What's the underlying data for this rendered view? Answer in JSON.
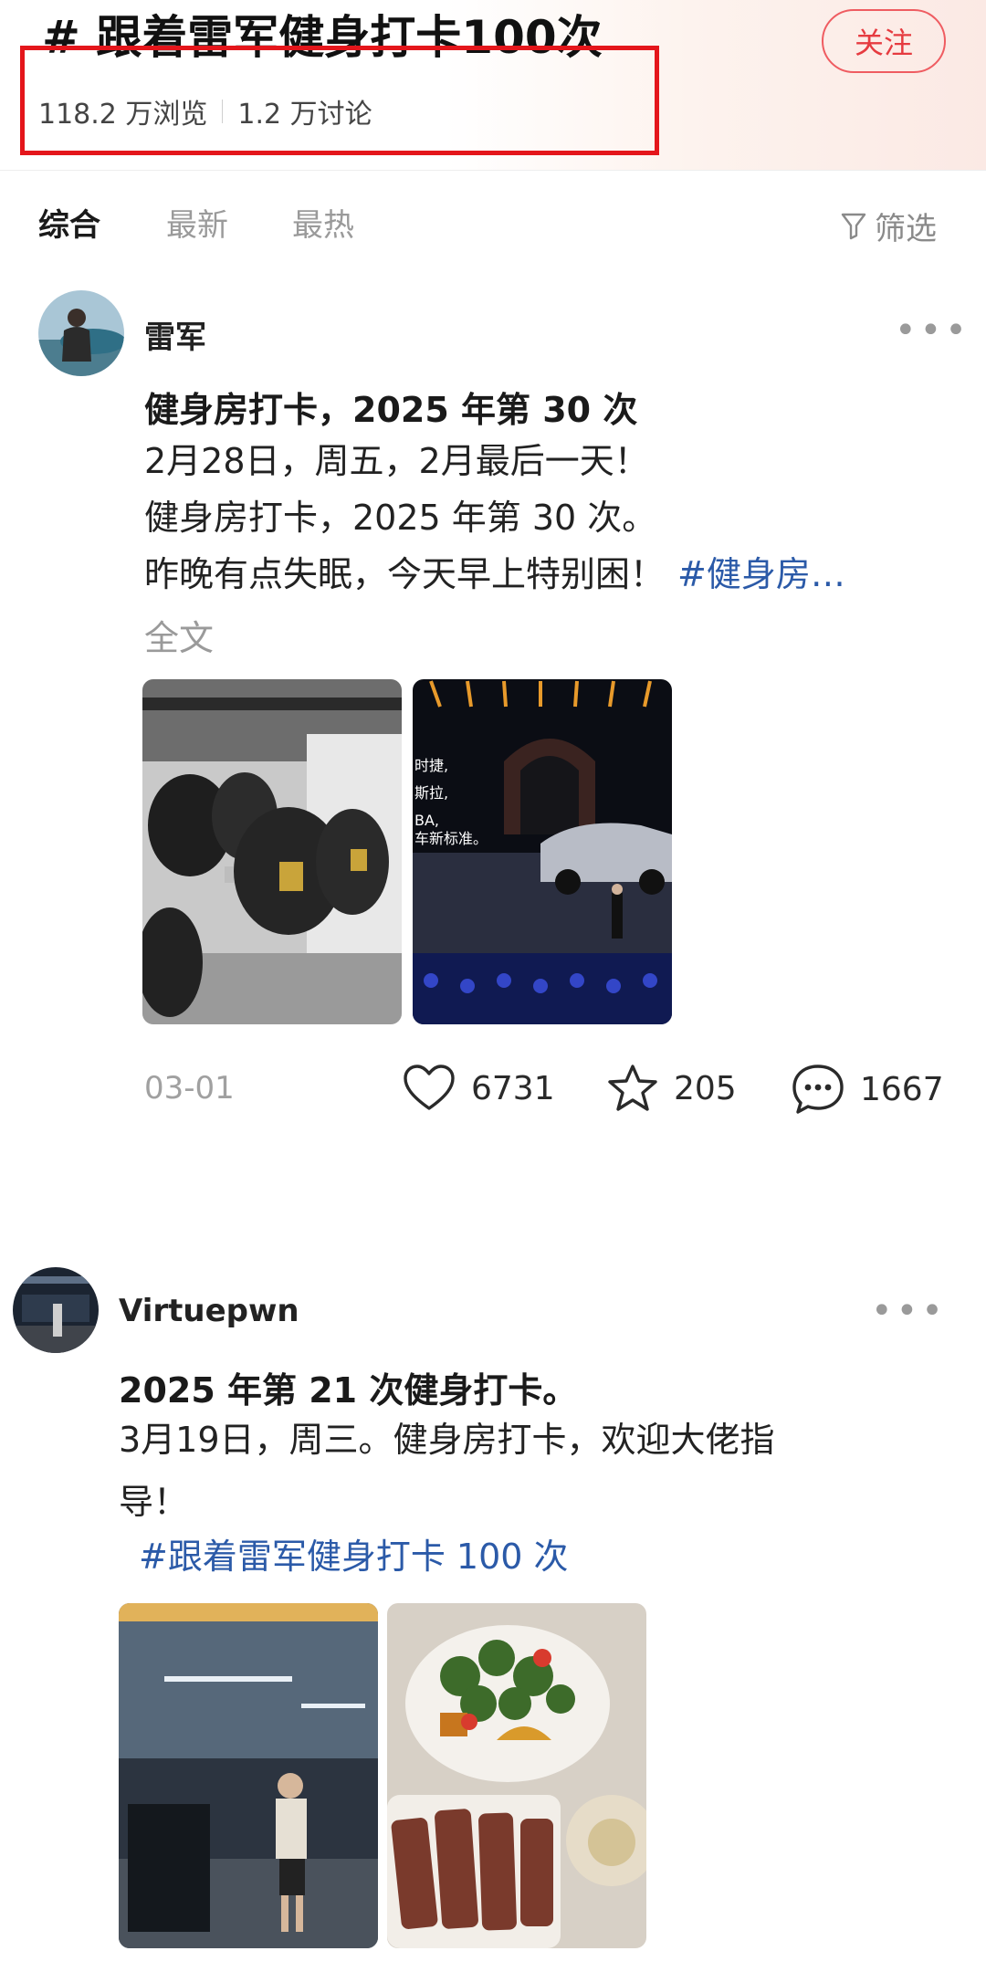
{
  "header": {
    "topic_title": "# 跟着雷军健身打卡100次",
    "views": "118.2 万浏览",
    "discussions": "1.2 万讨论",
    "follow_label": "关注",
    "highlight_color": "#e4161b"
  },
  "tabs": {
    "items": [
      {
        "label": "综合",
        "active": true
      },
      {
        "label": "最新",
        "active": false
      },
      {
        "label": "最热",
        "active": false
      }
    ],
    "filter_label": "筛选"
  },
  "posts": [
    {
      "username": "雷军",
      "title": "健身房打卡，2025 年第 30 次",
      "lines": [
        "2月28日，周五，2月最后一天！",
        "健身房打卡，2025 年第 30 次。",
        "昨晚有点失眠，今天早上特别困！"
      ],
      "tag": "#健身房…",
      "full_text_label": "全文",
      "image_overlay_text": [
        "时捷,",
        "斯拉,",
        "BA,",
        "车新标准。"
      ],
      "date": "03-01",
      "likes": "6731",
      "favorites": "205",
      "comments": "1667"
    },
    {
      "username": "Virtuepwn",
      "title": "2025 年第 21 次健身打卡。",
      "lines": [
        "3月19日，周三。健身房打卡，欢迎大佬指",
        "导！"
      ],
      "tag": "#跟着雷军健身打卡 100 次"
    }
  ],
  "icons": {
    "filter": "filter-funnel-icon",
    "like": "heart-icon",
    "favorite": "star-icon",
    "comment": "chat-bubble-icon",
    "more": "more-dots-icon"
  }
}
